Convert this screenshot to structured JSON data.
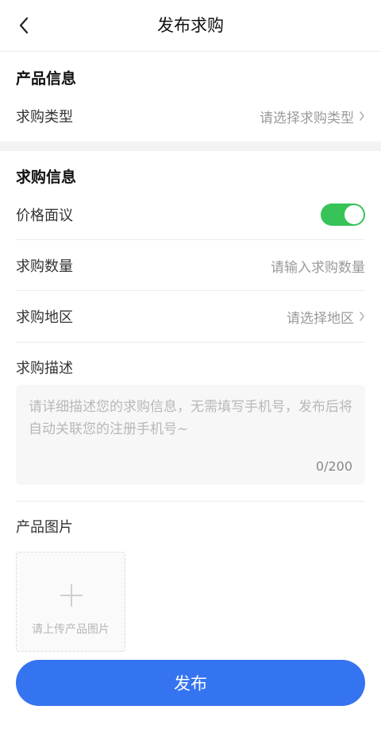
{
  "header": {
    "title": "发布求购",
    "back_icon": "chevron-left-icon"
  },
  "product_info": {
    "section_title": "产品信息",
    "type_row": {
      "label": "求购类型",
      "value": "请选择求购类型"
    }
  },
  "purchase_info": {
    "section_title": "求购信息",
    "negotiable_row": {
      "label": "价格面议",
      "toggle_on": true,
      "toggle_color": "#36c358"
    },
    "quantity_row": {
      "label": "求购数量",
      "placeholder": "请输入求购数量"
    },
    "region_row": {
      "label": "求购地区",
      "value": "请选择地区"
    },
    "description": {
      "label": "求购描述",
      "placeholder": "请详细描述您的求购信息，无需填写手机号，发布后将自动关联您的注册手机号~",
      "counter": "0/200"
    },
    "images": {
      "label": "产品图片",
      "upload_label": "请上传产品图片"
    }
  },
  "submit": {
    "label": "发布",
    "color": "#3574f0"
  }
}
